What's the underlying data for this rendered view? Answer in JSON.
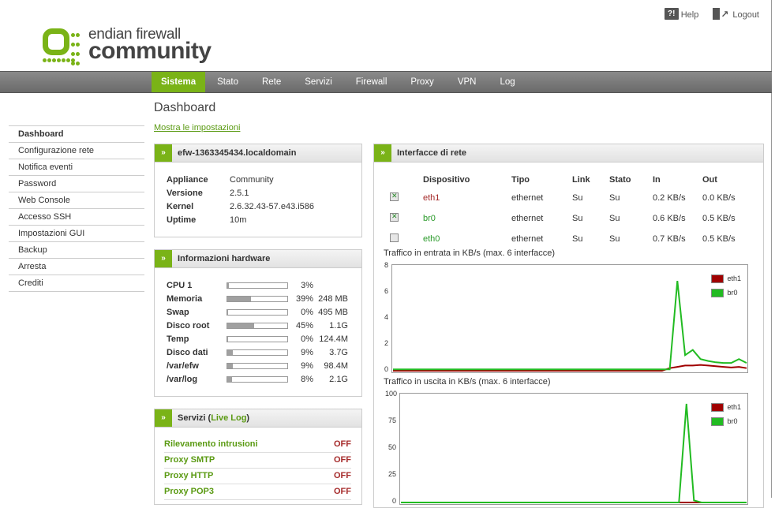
{
  "header": {
    "help_label": "Help",
    "logout_label": "Logout",
    "logo_line1": "endian firewall",
    "logo_line2": "community"
  },
  "nav": {
    "items": [
      "Sistema",
      "Stato",
      "Rete",
      "Servizi",
      "Firewall",
      "Proxy",
      "VPN",
      "Log"
    ],
    "active": "Sistema"
  },
  "page": {
    "title": "Dashboard",
    "show_settings": "Mostra le impostazioni"
  },
  "sidebar": {
    "items": [
      "Dashboard",
      "Configurazione rete",
      "Notifica eventi",
      "Password",
      "Web Console",
      "Accesso SSH",
      "Impostazioni GUI",
      "Backup",
      "Arresta",
      "Crediti"
    ]
  },
  "system_panel": {
    "title": "efw-1363345434.localdomain",
    "rows": [
      {
        "k": "Appliance",
        "v": "Community"
      },
      {
        "k": "Versione",
        "v": "2.5.1"
      },
      {
        "k": "Kernel",
        "v": "2.6.32.43-57.e43.i586"
      },
      {
        "k": "Uptime",
        "v": "10m"
      }
    ]
  },
  "hardware_panel": {
    "title": "Informazioni hardware",
    "rows": [
      {
        "k": "CPU 1",
        "pct": "3%",
        "size": "",
        "level": 0.03
      },
      {
        "k": "Memoria",
        "pct": "39%",
        "size": "248 MB",
        "level": 0.39
      },
      {
        "k": "Swap",
        "pct": "0%",
        "size": "495 MB",
        "level": 0.0
      },
      {
        "k": "Disco root",
        "pct": "45%",
        "size": "1.1G",
        "level": 0.45
      },
      {
        "k": "Temp",
        "pct": "0%",
        "size": "124.4M",
        "level": 0.0
      },
      {
        "k": "Disco dati",
        "pct": "9%",
        "size": "3.7G",
        "level": 0.09
      },
      {
        "k": "/var/efw",
        "pct": "9%",
        "size": "98.4M",
        "level": 0.09
      },
      {
        "k": "/var/log",
        "pct": "8%",
        "size": "2.1G",
        "level": 0.08
      }
    ]
  },
  "services_panel": {
    "title": "Servizi (",
    "live_log": "Live Log",
    "title_end": ")",
    "rows": [
      {
        "name": "Rilevamento intrusioni",
        "status": "OFF"
      },
      {
        "name": "Proxy SMTP",
        "status": "OFF"
      },
      {
        "name": "Proxy HTTP",
        "status": "OFF"
      },
      {
        "name": "Proxy POP3",
        "status": "OFF"
      }
    ]
  },
  "interfaces_panel": {
    "title": "Interfacce di rete",
    "columns": [
      "Dispositivo",
      "Tipo",
      "Link",
      "Stato",
      "In",
      "Out"
    ],
    "rows": [
      {
        "checked": true,
        "device": "eth1",
        "type": "ethernet",
        "link": "Su",
        "state": "Su",
        "in": "0.2 KB/s",
        "out": "0.0 KB/s",
        "color": "#a52a2a"
      },
      {
        "checked": true,
        "device": "br0",
        "type": "ethernet",
        "link": "Su",
        "state": "Su",
        "in": "0.6 KB/s",
        "out": "0.5 KB/s",
        "color": "#2a9a2a"
      },
      {
        "checked": false,
        "device": "eth0",
        "type": "ethernet",
        "link": "Su",
        "state": "Su",
        "in": "0.7 KB/s",
        "out": "0.5 KB/s",
        "color": "#2a9a2a"
      }
    ]
  },
  "chart_data": [
    {
      "type": "line",
      "title": "Traffico in entrata in KB/s (max. 6 interfacce)",
      "ylim": [
        0,
        8
      ],
      "yticks": [
        0,
        2,
        4,
        6,
        8
      ],
      "legend_position": "top-right",
      "series": [
        {
          "name": "eth1",
          "color": "#a00000",
          "values": [
            0,
            0,
            0,
            0,
            0,
            0,
            0,
            0,
            0,
            0,
            0,
            0,
            0,
            0,
            0,
            0,
            0,
            0,
            0,
            0,
            0,
            0,
            0,
            0,
            0,
            0,
            0,
            0,
            0,
            0,
            0,
            0,
            0,
            0,
            0,
            0,
            0.2,
            0.3,
            0.4,
            0.4,
            0.45,
            0.4,
            0.35,
            0.3,
            0.25,
            0.3,
            0.2
          ]
        },
        {
          "name": "br0",
          "color": "#22bb22",
          "values": [
            0.1,
            0.1,
            0.1,
            0.1,
            0.1,
            0.1,
            0.1,
            0.1,
            0.1,
            0.1,
            0.1,
            0.1,
            0.1,
            0.1,
            0.1,
            0.1,
            0.1,
            0.1,
            0.1,
            0.1,
            0.1,
            0.1,
            0.1,
            0.1,
            0.1,
            0.1,
            0.1,
            0.1,
            0.1,
            0.1,
            0.1,
            0.1,
            0.1,
            0.1,
            0.1,
            0.1,
            0.1,
            6.9,
            1.2,
            1.6,
            0.9,
            0.75,
            0.65,
            0.6,
            0.6,
            0.9,
            0.6
          ]
        }
      ]
    },
    {
      "type": "line",
      "title": "Traffico in uscita in KB/s (max. 6 interfacce)",
      "ylim": [
        0,
        100
      ],
      "yticks": [
        0,
        25,
        50,
        75,
        100
      ],
      "legend_position": "top-right",
      "series": [
        {
          "name": "eth1",
          "color": "#a00000",
          "values": [
            0,
            0,
            0,
            0,
            0,
            0,
            0,
            0,
            0,
            0,
            0,
            0,
            0,
            0,
            0,
            0,
            0,
            0,
            0,
            0,
            0,
            0,
            0,
            0,
            0,
            0,
            0,
            0,
            0,
            0,
            0,
            0,
            0,
            0,
            0,
            0,
            0,
            0,
            0,
            0,
            0,
            0,
            0,
            0,
            0,
            0,
            0
          ]
        },
        {
          "name": "br0",
          "color": "#22bb22",
          "values": [
            0,
            0,
            0,
            0,
            0,
            0,
            0,
            0,
            0,
            0,
            0,
            0,
            0,
            0,
            0,
            0,
            0,
            0,
            0,
            0,
            0,
            0,
            0,
            0,
            0,
            0,
            0,
            0,
            0,
            0,
            0,
            0,
            0,
            0,
            0,
            0,
            0,
            0,
            92,
            2,
            0,
            0,
            0,
            0,
            0,
            0,
            0
          ]
        }
      ]
    }
  ]
}
